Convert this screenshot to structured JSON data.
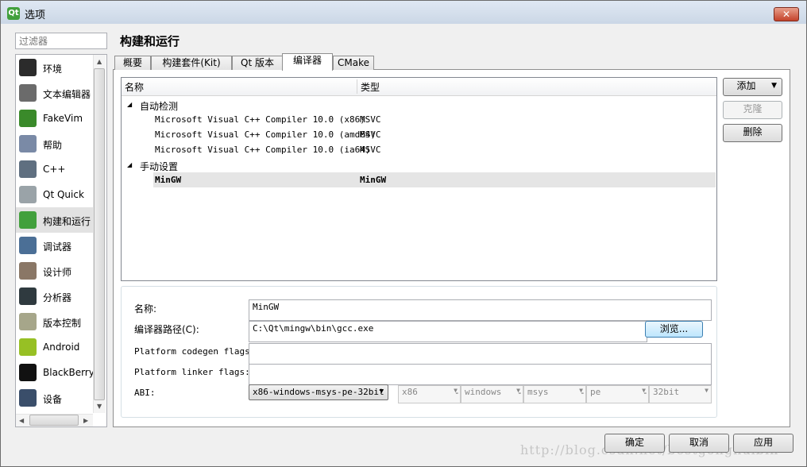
{
  "window": {
    "title": "选项",
    "app_icon": "qt-icon",
    "close_glyph": "✕"
  },
  "filter": {
    "placeholder": "过滤器"
  },
  "sidebar": {
    "items": [
      {
        "label": "环境",
        "icon": "monitor-icon",
        "color": "#2b2b2b"
      },
      {
        "label": "文本编辑器",
        "icon": "text-editor-icon",
        "color": "#6b6b6b"
      },
      {
        "label": "FakeVim",
        "icon": "fakevim-icon",
        "color": "#3a8a2a"
      },
      {
        "label": "帮助",
        "icon": "help-icon",
        "color": "#7a8aa6"
      },
      {
        "label": "C++",
        "icon": "braces-icon",
        "color": "#5f6f80"
      },
      {
        "label": "Qt Quick",
        "icon": "paper-plane-icon",
        "color": "#9aa3a8"
      },
      {
        "label": "构建和运行",
        "icon": "build-run-icon",
        "color": "#41a03c"
      },
      {
        "label": "调试器",
        "icon": "debugger-icon",
        "color": "#4b6f96"
      },
      {
        "label": "设计师",
        "icon": "designer-icon",
        "color": "#8a7766"
      },
      {
        "label": "分析器",
        "icon": "analyzer-icon",
        "color": "#2f3a3f"
      },
      {
        "label": "版本控制",
        "icon": "version-control-icon",
        "color": "#a6a68a"
      },
      {
        "label": "Android",
        "icon": "android-icon",
        "color": "#97c024"
      },
      {
        "label": "BlackBerry",
        "icon": "blackberry-icon",
        "color": "#111111"
      },
      {
        "label": "设备",
        "icon": "device-icon",
        "color": "#3a4e6a"
      }
    ],
    "selected_index": 6
  },
  "page": {
    "title": "构建和运行"
  },
  "tabs": [
    {
      "label": "概要"
    },
    {
      "label": "构建套件(Kit)"
    },
    {
      "label": "Qt 版本"
    },
    {
      "label": "编译器",
      "active": true
    },
    {
      "label": "CMake"
    }
  ],
  "tree": {
    "columns": [
      "名称",
      "类型"
    ],
    "groups": [
      {
        "label": "自动检测",
        "rows": [
          {
            "name": "Microsoft Visual C++ Compiler 10.0 (x86)",
            "type": "MSVC"
          },
          {
            "name": "Microsoft Visual C++ Compiler 10.0 (amd64)",
            "type": "MSVC"
          },
          {
            "name": "Microsoft Visual C++ Compiler 10.0 (ia64)",
            "type": "MSVC"
          }
        ]
      },
      {
        "label": "手动设置",
        "rows": [
          {
            "name": "MinGW",
            "type": "MinGW",
            "selected": true
          }
        ]
      }
    ]
  },
  "buttons": {
    "add": "添加",
    "clone": "克隆",
    "remove": "删除",
    "browse": "浏览...",
    "ok": "确定",
    "cancel": "取消",
    "apply": "应用"
  },
  "details": {
    "name_label": "名称:",
    "name_value": "MinGW",
    "path_label": "编译器路径(C):",
    "path_value": "C:\\Qt\\mingw\\bin\\gcc.exe",
    "codegen_label": "Platform codegen flags:",
    "codegen_value": "",
    "linker_label": "Platform linker flags:",
    "linker_value": "",
    "abi_label": "ABI:",
    "abi_value": "x86-windows-msys-pe-32bit",
    "abi_parts": [
      "x86",
      "windows",
      "msys",
      "pe",
      "32bit"
    ]
  },
  "watermark": "http://blog.csdn.net/bestgonghuibin"
}
